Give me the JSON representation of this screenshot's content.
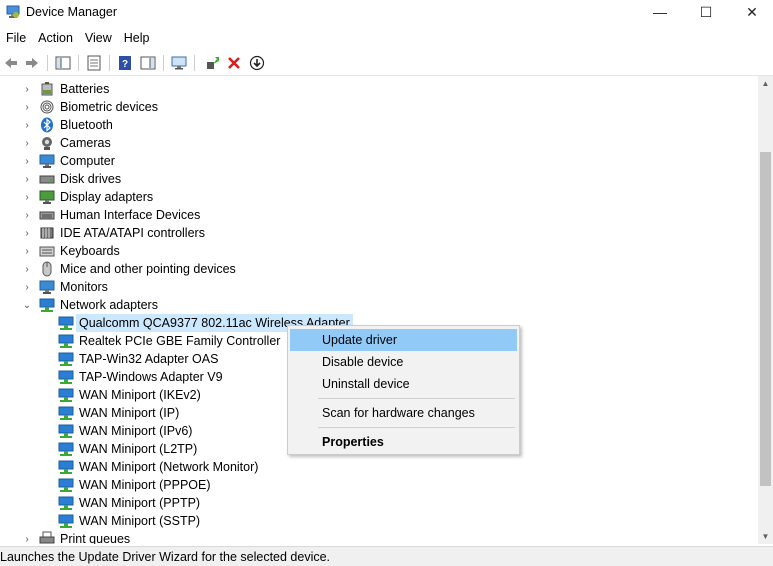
{
  "window": {
    "title": "Device Manager",
    "minimize_glyph": "—",
    "maximize_glyph": "☐",
    "close_glyph": "✕"
  },
  "menubar": {
    "items": [
      "File",
      "Action",
      "View",
      "Help"
    ]
  },
  "toolbar": {
    "buttons": [
      "back-icon",
      "forward-icon",
      "show-hide-console-tree-icon",
      "properties-icon",
      "help-icon",
      "action-pane-icon",
      "scan-hardware-icon",
      "update-driver-icon",
      "uninstall-device-icon",
      "disable-device-icon"
    ]
  },
  "tree": {
    "categories": [
      {
        "label": "Batteries",
        "icon": "battery-icon",
        "expanded": false
      },
      {
        "label": "Biometric devices",
        "icon": "fingerprint-icon",
        "expanded": false
      },
      {
        "label": "Bluetooth",
        "icon": "bluetooth-icon",
        "expanded": false
      },
      {
        "label": "Cameras",
        "icon": "camera-icon",
        "expanded": false
      },
      {
        "label": "Computer",
        "icon": "computer-icon",
        "expanded": false
      },
      {
        "label": "Disk drives",
        "icon": "disk-drive-icon",
        "expanded": false
      },
      {
        "label": "Display adapters",
        "icon": "display-adapter-icon",
        "expanded": false
      },
      {
        "label": "Human Interface Devices",
        "icon": "hid-icon",
        "expanded": false
      },
      {
        "label": "IDE ATA/ATAPI controllers",
        "icon": "ide-controller-icon",
        "expanded": false
      },
      {
        "label": "Keyboards",
        "icon": "keyboard-icon",
        "expanded": false
      },
      {
        "label": "Mice and other pointing devices",
        "icon": "mouse-icon",
        "expanded": false
      },
      {
        "label": "Monitors",
        "icon": "monitor-icon",
        "expanded": false
      },
      {
        "label": "Network adapters",
        "icon": "network-adapter-icon",
        "expanded": true
      }
    ],
    "network_adapters": [
      {
        "label": "Qualcomm QCA9377 802.11ac Wireless Adapter",
        "selected": true
      },
      {
        "label": "Realtek PCIe GBE Family Controller"
      },
      {
        "label": "TAP-Win32 Adapter OAS"
      },
      {
        "label": "TAP-Windows Adapter V9"
      },
      {
        "label": "WAN Miniport (IKEv2)"
      },
      {
        "label": "WAN Miniport (IP)"
      },
      {
        "label": "WAN Miniport (IPv6)"
      },
      {
        "label": "WAN Miniport (L2TP)"
      },
      {
        "label": "WAN Miniport (Network Monitor)"
      },
      {
        "label": "WAN Miniport (PPPOE)"
      },
      {
        "label": "WAN Miniport (PPTP)"
      },
      {
        "label": "WAN Miniport (SSTP)"
      }
    ],
    "next_category": {
      "label": "Print queues",
      "icon": "printer-icon"
    }
  },
  "context_menu": {
    "items": [
      {
        "label": "Update driver",
        "highlighted": true
      },
      {
        "label": "Disable device"
      },
      {
        "label": "Uninstall device"
      },
      {
        "label": "Scan for hardware changes"
      },
      {
        "label": "Properties",
        "bold": true
      }
    ]
  },
  "statusbar": {
    "text": "Launches the Update Driver Wizard for the selected device."
  },
  "colors": {
    "selection": "#cce8ff",
    "menu_highlight": "#91c9f7",
    "network_icon": "#2a7fd4",
    "network_plug": "#3aa935",
    "uninstall_red": "#d81e1e"
  }
}
